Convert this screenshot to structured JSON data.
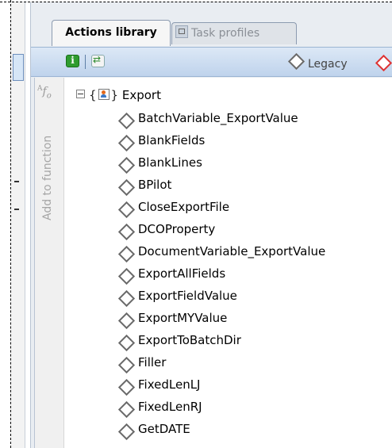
{
  "tabs": {
    "active": "Actions library",
    "inactive": "Task profiles"
  },
  "toolbar": {
    "legacy_label": "Legacy"
  },
  "sidebar": {
    "vertical_label": "Add to function",
    "fx_icon": "function-icon"
  },
  "tree": {
    "root_label": "Export",
    "items": [
      "BatchVariable_ExportValue",
      "BlankFields",
      "BlankLines",
      "BPilot",
      "CloseExportFile",
      "DCOProperty",
      "DocumentVariable_ExportValue",
      "ExportAllFields",
      "ExportFieldValue",
      "ExportMYValue",
      "ExportToBatchDir",
      "Filler",
      "FixedLenLJ",
      "FixedLenRJ",
      "GetDATE"
    ]
  },
  "colors": {
    "toolbar_top": "#dce8f6",
    "toolbar_bottom": "#bfd3ec",
    "legacy_diamond": "#6a6a6a",
    "new_diamond": "#d33"
  }
}
